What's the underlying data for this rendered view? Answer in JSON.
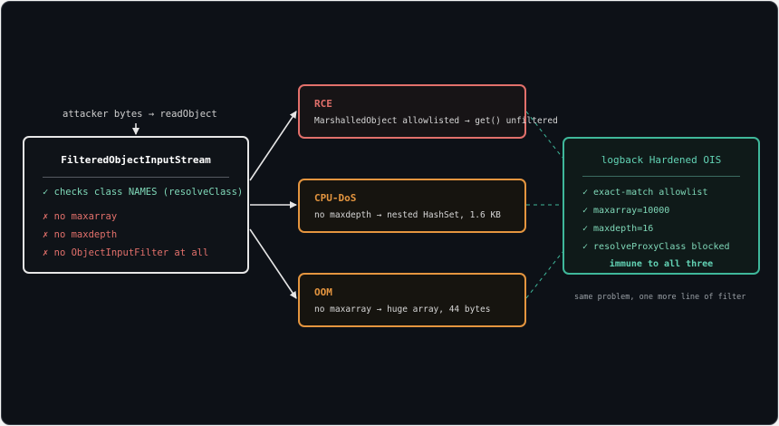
{
  "input_label": "attacker bytes → readObject",
  "filter_box": {
    "title": "FilteredObjectInputStream",
    "check": "✓ checks class NAMES (resolveClass)",
    "missing": [
      "✗ no maxarray",
      "✗ no maxdepth",
      "✗ no ObjectInputFilter at all"
    ]
  },
  "risks": [
    {
      "title": "RCE",
      "desc": "MarshalledObject allowlisted → get() unfiltered",
      "color": "#e2706b"
    },
    {
      "title": "CPU-DoS",
      "desc": "no maxdepth → nested HashSet, 1.6 KB",
      "color": "#e4953f"
    },
    {
      "title": "OOM",
      "desc": "no maxarray → huge array, 44 bytes",
      "color": "#e4953f"
    }
  ],
  "hardened_box": {
    "title": "logback Hardened OIS",
    "items": [
      "✓ exact-match allowlist",
      "✓ maxarray=10000",
      "✓ maxdepth=16",
      "✓ resolveProxyClass blocked"
    ],
    "footer": "immune to all three"
  },
  "note": "same problem, one more line of filter",
  "colors": {
    "background": "#0d1117",
    "danger": "#e2706b",
    "warning": "#e4953f",
    "safe": "#3fb79a"
  }
}
